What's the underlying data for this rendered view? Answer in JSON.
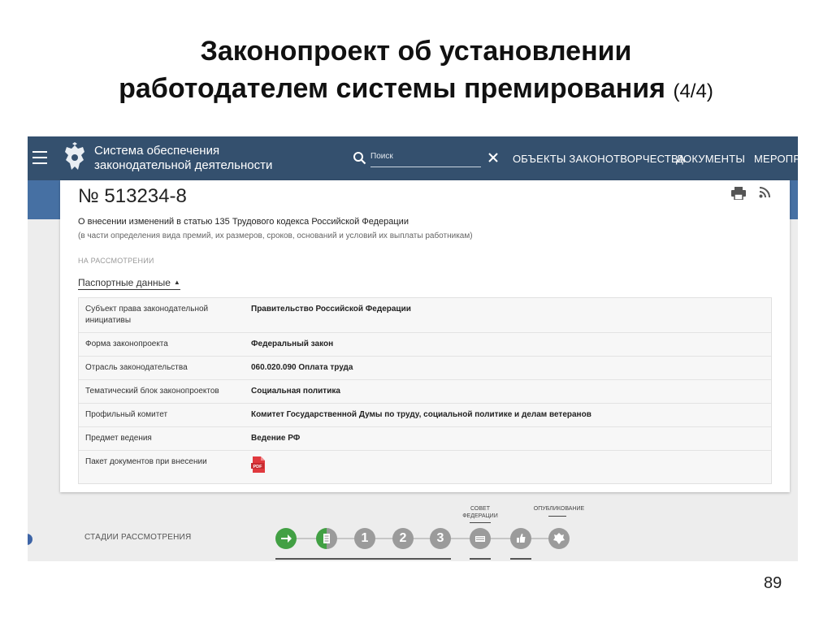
{
  "slide": {
    "title_line1": "Законопроект об установлении",
    "title_line2": "работодателем системы премирования",
    "title_suffix": "(4/4)",
    "page_number": "89"
  },
  "header": {
    "brand_line1": "Система обеспечения",
    "brand_line2": "законодательной деятельности",
    "search_placeholder": "Поиск",
    "nav": [
      "ОБЪЕКТЫ ЗАКОНОТВОРЧЕСТВА",
      "ДОКУМЕНТЫ",
      "МЕРОПРИ"
    ]
  },
  "bill": {
    "number": "№ 513234-8",
    "title": "О внесении изменений в статью 135 Трудового кодекса Российской Федерации",
    "subtitle": "(в части определения вида премий, их размеров, сроков, оснований и условий их выплаты работникам)",
    "status": "НА РАССМОТРЕНИИ",
    "section_label": "Паспортные данные"
  },
  "passport": [
    {
      "label": "Субъект права законодательной инициативы",
      "value": "Правительство Российской Федерации"
    },
    {
      "label": "Форма законопроекта",
      "value": "Федеральный закон"
    },
    {
      "label": "Отрасль законодательства",
      "value": "060.020.090 Оплата труда"
    },
    {
      "label": "Тематический блок законопроектов",
      "value": "Социальная политика"
    },
    {
      "label": "Профильный комитет",
      "value": "Комитет Государственной Думы по труду, социальной политике и делам ветеранов"
    },
    {
      "label": "Предмет ведения",
      "value": "Ведение РФ"
    },
    {
      "label": "Пакет документов при внесении",
      "value": ""
    }
  ],
  "stages": {
    "label": "СТАДИИ РАССМОТРЕНИЯ",
    "council_caption": "СОВЕТ ФЕДЕРАЦИИ",
    "publication_caption": "ОПУБЛИКОВАНИЕ",
    "numbers": [
      "1",
      "2",
      "3"
    ]
  },
  "colors": {
    "header_bg": "#34506e",
    "band_bg": "#4670a3",
    "stage_done": "#42a044",
    "stage_pending": "#9b9b9b",
    "pdf_red": "#e0393e"
  }
}
